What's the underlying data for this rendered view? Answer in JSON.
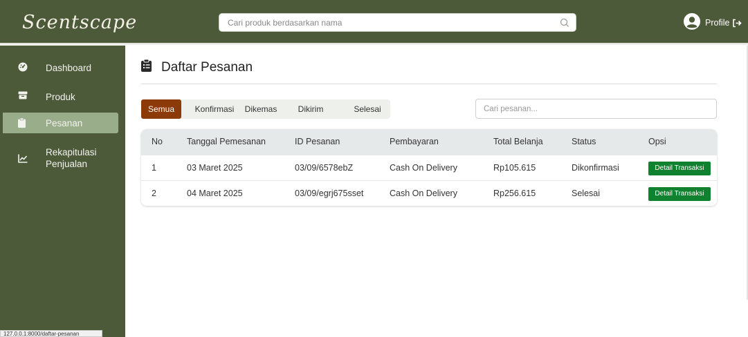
{
  "app": {
    "logo_text": "Scentscape",
    "search_placeholder": "Cari produk berdasarkan nama",
    "profile_label": "Profile"
  },
  "sidebar": {
    "items": [
      {
        "label": "Dashboard",
        "icon": "dashboard-icon"
      },
      {
        "label": "Produk",
        "icon": "box-icon"
      },
      {
        "label": "Pesanan",
        "icon": "clipboard-icon",
        "active": true
      },
      {
        "label": "Rekapitulasi",
        "label2": "Penjualan",
        "icon": "chart-line-icon"
      }
    ]
  },
  "status_bar_url": "127.0.0.1:8000/daftar-pesanan",
  "page": {
    "title": "Daftar Pesanan",
    "tabs": [
      "Semua",
      "Konfirmasi",
      "Dikemas",
      "Dikirim",
      "Selesai"
    ],
    "active_tab": "Semua",
    "order_search_placeholder": "Cari pesanan..."
  },
  "table": {
    "headers": [
      "No",
      "Tanggal Pemesanan",
      "ID Pesanan",
      "Pembayaran",
      "Total Belanja",
      "Status",
      "Opsi"
    ],
    "rows": [
      {
        "no": "1",
        "date": "03 Maret 2025",
        "id": "03/09/6578ebZ",
        "payment": "Cash On Delivery",
        "total": "Rp105.615",
        "status": "Dikonfirmasi",
        "action": "Detail Transaksi"
      },
      {
        "no": "2",
        "date": "04 Maret 2025",
        "id": "03/09/egrj675sset",
        "payment": "Cash On Delivery",
        "total": "Rp256.615",
        "status": "Selesai",
        "action": "Detail Transaksi"
      }
    ]
  },
  "colors": {
    "primary": "#4d5a3a",
    "sidebar_active": "#9aad8a",
    "tab_active": "#8b3a08",
    "detail_button": "#10822f"
  }
}
